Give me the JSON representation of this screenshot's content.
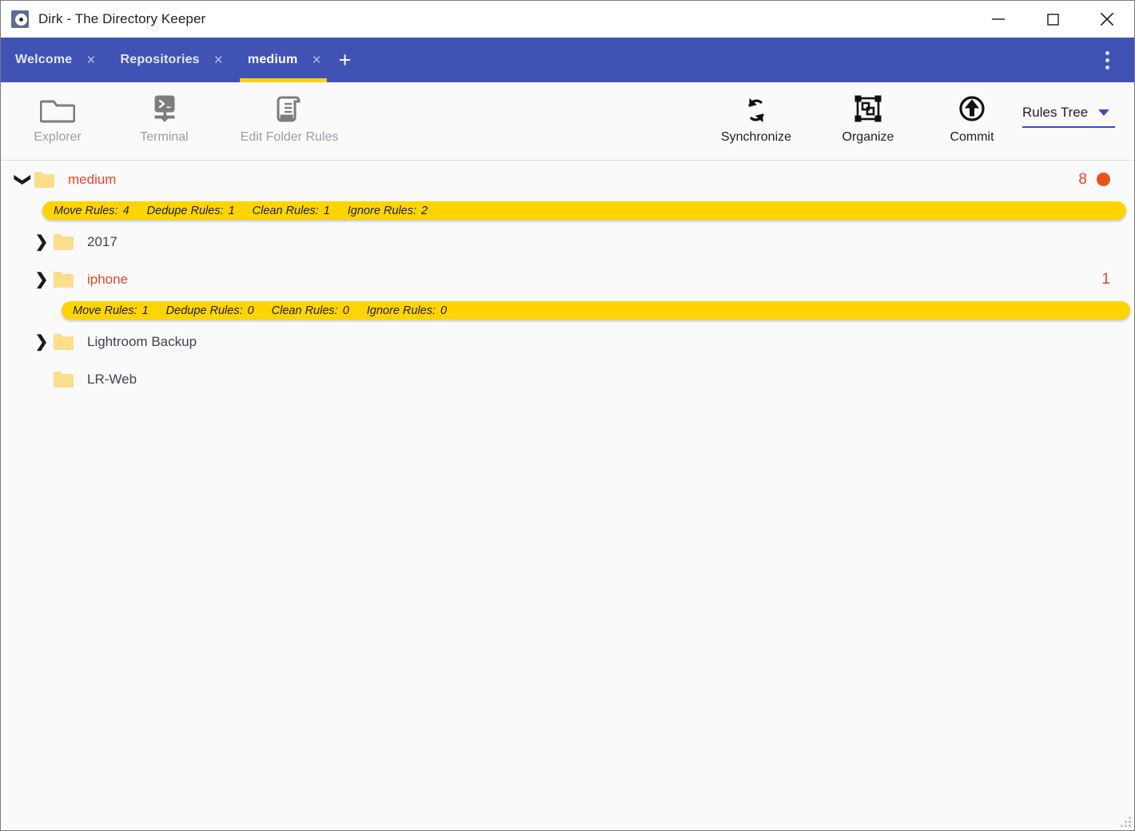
{
  "window": {
    "title": "Dirk - The Directory Keeper",
    "app_icon": "disc-icon",
    "controls": {
      "minimize": "minimize-icon",
      "maximize": "maximize-icon",
      "close": "close-icon"
    }
  },
  "tabbar": {
    "tabs": [
      {
        "label": "Welcome",
        "active": false,
        "close": "×"
      },
      {
        "label": "Repositories",
        "active": false,
        "close": "×"
      },
      {
        "label": "medium",
        "active": true,
        "close": "×"
      }
    ],
    "add_label": "+",
    "overflow_menu": "more-vertical-icon",
    "accent": "#fdd017",
    "background": "#4053b5"
  },
  "toolbar": {
    "left_items": [
      {
        "label": "Explorer",
        "icon": "folder-icon",
        "enabled": false
      },
      {
        "label": "Terminal",
        "icon": "terminal-icon",
        "enabled": false
      },
      {
        "label": "Edit Folder Rules",
        "icon": "document-rules-icon",
        "enabled": false
      }
    ],
    "right_items": [
      {
        "label": "Synchronize",
        "icon": "sync-icon",
        "enabled": true
      },
      {
        "label": "Organize",
        "icon": "organize-icon",
        "enabled": true
      },
      {
        "label": "Commit",
        "icon": "commit-upload-icon",
        "enabled": true
      }
    ],
    "view_select": {
      "label": "Rules Tree",
      "caret": "chevron-down-icon",
      "accent": "#3b4fb8"
    }
  },
  "tree": {
    "rows": [
      {
        "kind": "folder",
        "name": "medium",
        "indent": 0,
        "arrow": "expanded",
        "has_rules": true,
        "count": "8",
        "dot": true
      },
      {
        "kind": "rulesbar",
        "indent": 0,
        "rules": [
          {
            "label": "Move Rules:",
            "value": "4"
          },
          {
            "label": "Dedupe Rules:",
            "value": "1"
          },
          {
            "label": "Clean Rules:",
            "value": "1"
          },
          {
            "label": "Ignore Rules:",
            "value": "2"
          }
        ]
      },
      {
        "kind": "folder",
        "name": "2017",
        "indent": 1,
        "arrow": "collapsed",
        "has_rules": false,
        "count": "",
        "dot": false
      },
      {
        "kind": "folder",
        "name": "iphone",
        "indent": 1,
        "arrow": "collapsed",
        "has_rules": true,
        "count": "1",
        "dot": false
      },
      {
        "kind": "rulesbar",
        "indent": 1,
        "rules": [
          {
            "label": "Move Rules:",
            "value": "1"
          },
          {
            "label": "Dedupe Rules:",
            "value": "0"
          },
          {
            "label": "Clean Rules:",
            "value": "0"
          },
          {
            "label": "Ignore Rules:",
            "value": "0"
          }
        ]
      },
      {
        "kind": "folder",
        "name": "Lightroom Backup",
        "indent": 1,
        "arrow": "collapsed",
        "has_rules": false,
        "count": "",
        "dot": false
      },
      {
        "kind": "folder",
        "name": "LR-Web",
        "indent": 1,
        "arrow": "none",
        "has_rules": false,
        "count": "",
        "dot": false
      }
    ],
    "colors": {
      "rule_folder_text": "#e8452c",
      "plain_folder_text": "#3c4450",
      "folder_icon": "#fbdd8c",
      "rules_pill": "#ffd400",
      "badge": "#e8452c",
      "dot": "#e8531a"
    }
  },
  "statusbar": {
    "resize_grip": "resize-grip-icon"
  }
}
